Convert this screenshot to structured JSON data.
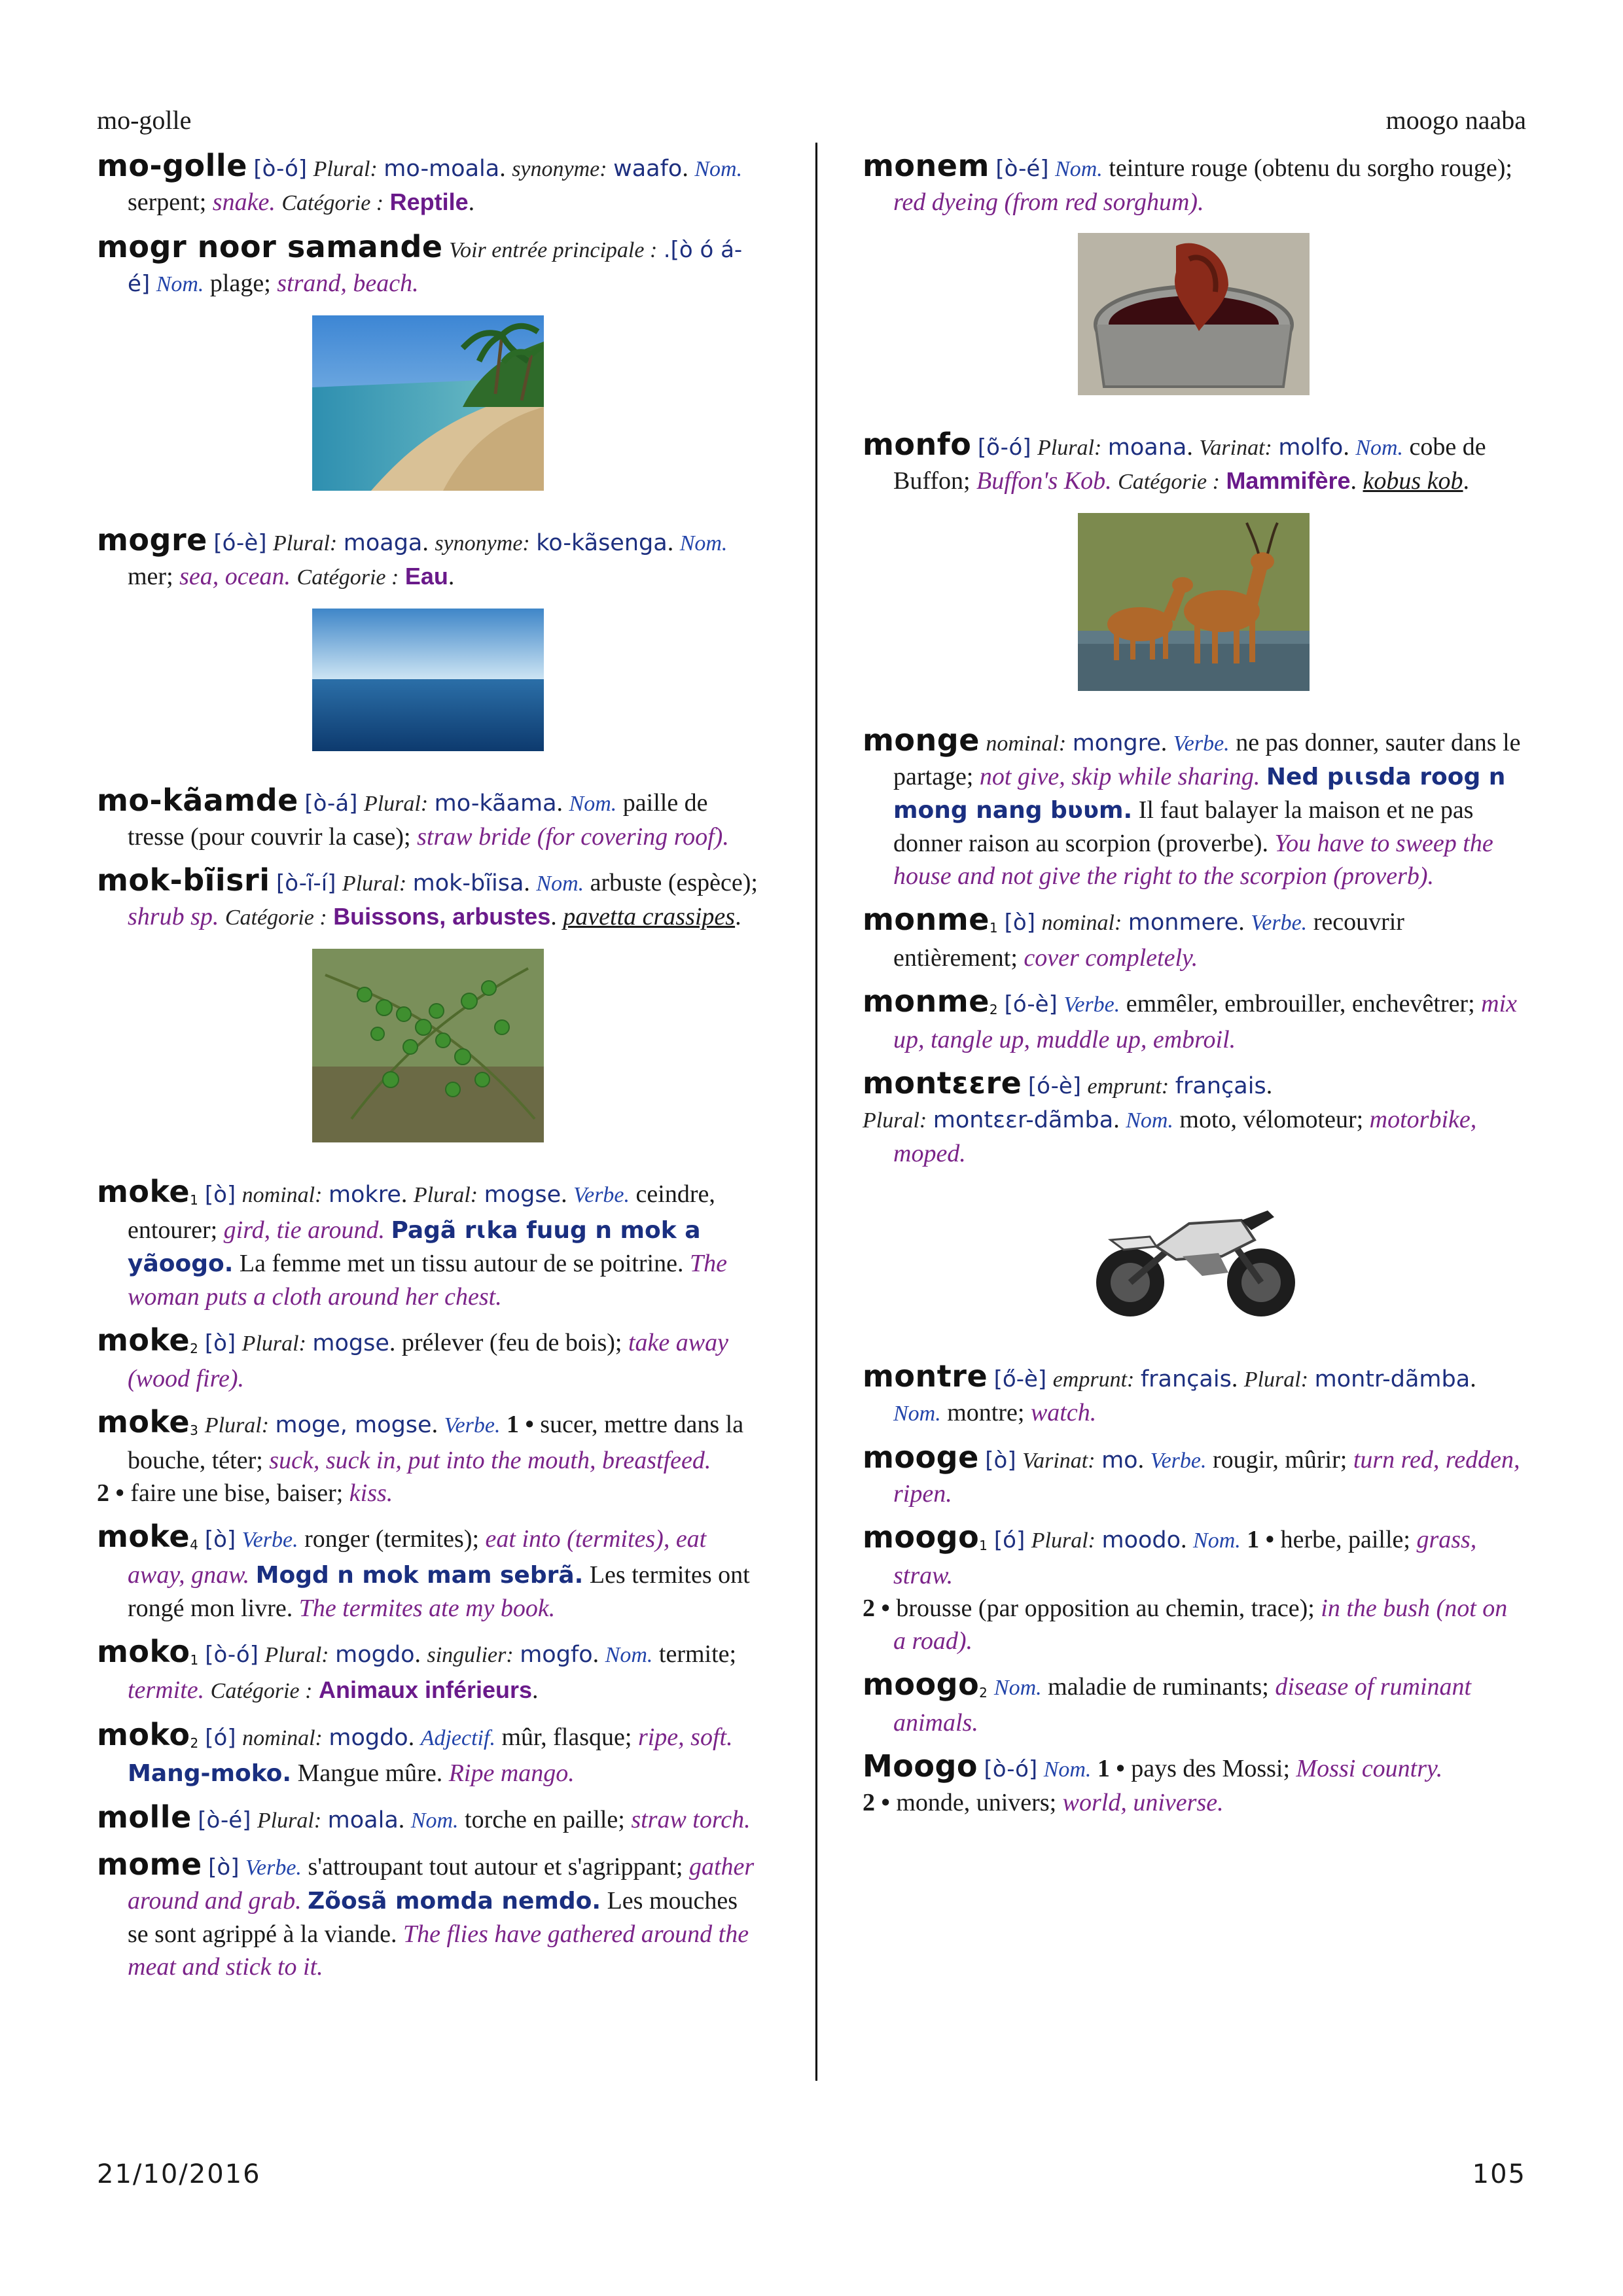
{
  "header": {
    "left": "mo-golle",
    "right": "moogo naaba"
  },
  "footer": {
    "date": "21/10/2016",
    "page": "105"
  },
  "entries": {
    "mogolle": {
      "hw": "mo-golle",
      "pron": "[ò-ó]",
      "plural_lbl": "Plural:",
      "plural": "mo-moala",
      "syn_lbl": "synonyme:",
      "syn": "waafo",
      "pos": "Nom.",
      "fr": "serpent;",
      "en": "snake.",
      "cat_lbl": "Catégorie :",
      "cat": "Reptile"
    },
    "mogr": {
      "hw": "mogr noor samande",
      "voir": "Voir entrée principale :",
      "pron": ".[ò ó á-é]",
      "pos": "Nom.",
      "fr": "plage;",
      "en": "strand, beach."
    },
    "mogre": {
      "hw": "mogre",
      "pron": "[ó-è]",
      "plural_lbl": "Plural:",
      "plural": "moaga",
      "syn_lbl": "synonyme:",
      "syn": "ko-kãsenga",
      "pos": "Nom.",
      "fr": "mer;",
      "en": "sea, ocean.",
      "cat_lbl": "Catégorie :",
      "cat": "Eau"
    },
    "mokaamde": {
      "hw": "mo-kãamde",
      "pron": "[ò-á]",
      "plural_lbl": "Plural:",
      "plural": "mo-kãama",
      "pos": "Nom.",
      "fr": "paille de tresse (pour couvrir la case);",
      "en": "straw bride (for covering roof)."
    },
    "mokbiisri": {
      "hw": "mok-bĩisri",
      "pron": "[ò-ĩ-í]",
      "plural_lbl": "Plural:",
      "plural": "mok-bĩisa",
      "pos": "Nom.",
      "fr": "arbuste (espèce);",
      "en": "shrub sp.",
      "cat_lbl": "Catégorie :",
      "cat": "Buissons, arbustes",
      "sci": "pavetta crassipes"
    },
    "moke1": {
      "hw": "moke",
      "hn": "1",
      "pron": "[ò]",
      "nominal_lbl": "nominal:",
      "nominal": "mokre",
      "plural_lbl": "Plural:",
      "plural": "mogse",
      "pos": "Verbe.",
      "fr": "ceindre, entourer;",
      "en": "gird, tie around.",
      "ex": "Pagã rɩka fuug n mok a yãoogo.",
      "ex_fr": "La femme met un tissu autour de se poitrine.",
      "ex_en": "The woman puts a cloth around her chest."
    },
    "moke2": {
      "hw": "moke",
      "hn": "2",
      "pron": "[ò]",
      "plural_lbl": "Plural:",
      "plural": "mogse",
      "fr": "prélever (feu de bois);",
      "en": "take away (wood fire)."
    },
    "moke3": {
      "hw": "moke",
      "hn": "3",
      "plural_lbl": "Plural:",
      "plural": "moge, mogse",
      "pos": "Verbe.",
      "s1": "1 •",
      "fr1": "sucer, mettre dans la bouche, téter;",
      "en1": "suck, suck in, put into the mouth, breastfeed.",
      "s2": "2 •",
      "fr2": "faire une bise, baiser;",
      "en2": "kiss."
    },
    "moke4": {
      "hw": "moke",
      "hn": "4",
      "pron": "[ò]",
      "pos": "Verbe.",
      "fr": "ronger (termites);",
      "en": "eat into (termites), eat away, gnaw.",
      "ex": "Mogd n mok mam sebrã.",
      "ex_fr": "Les termites ont rongé mon livre.",
      "ex_en": "The termites ate my book."
    },
    "moko1": {
      "hw": "moko",
      "hn": "1",
      "pron": "[ò-ó]",
      "plural_lbl": "Plural:",
      "plural": "mogdo",
      "sing_lbl": "singulier:",
      "sing": "mogfo",
      "pos": "Nom.",
      "fr": "termite;",
      "en": "termite.",
      "cat_lbl": "Catégorie :",
      "cat": "Animaux inférieurs"
    },
    "moko2": {
      "hw": "moko",
      "hn": "2",
      "pron": "[ó]",
      "nominal_lbl": "nominal:",
      "nominal": "mogdo",
      "pos": "Adjectif.",
      "fr": "mûr, flasque;",
      "en": "ripe, soft.",
      "ex": "Mang-moko.",
      "ex_fr": "Mangue mûre.",
      "ex_en": "Ripe mango."
    },
    "molle": {
      "hw": "molle",
      "pron": "[ò-é]",
      "plural_lbl": "Plural:",
      "plural": "moala",
      "pos": "Nom.",
      "fr": "torche en paille;",
      "en": "straw torch."
    },
    "mome": {
      "hw": "mome",
      "pron": "[ò]",
      "pos": "Verbe.",
      "fr": "s'attroupant tout autour et s'agrippant;",
      "en": "gather around and grab.",
      "ex": "Zõosã momda nemdo.",
      "ex_fr": "Les mouches se sont agrippé à la viande.",
      "ex_en": "The flies have gathered around the meat and stick to it."
    },
    "monem": {
      "hw": "monem",
      "pron": "[ò-é]",
      "pos": "Nom.",
      "fr": "teinture rouge (obtenu du sorgho rouge);",
      "en": "red dyeing (from red sorghum)."
    },
    "monfo": {
      "hw": "monfo",
      "pron": "[õ-ó]",
      "plural_lbl": "Plural:",
      "plural": "moana",
      "var_lbl": "Varinat:",
      "var": "molfo",
      "pos": "Nom.",
      "fr": "cobe de Buffon;",
      "en": "Buffon's Kob.",
      "cat_lbl": "Catégorie :",
      "cat": "Mammifère",
      "sci": "kobus kob"
    },
    "monge": {
      "hw": "monge",
      "nominal_lbl": "nominal:",
      "nominal": "mongre",
      "pos": "Verbe.",
      "fr": "ne pas donner, sauter dans le partage;",
      "en": "not give, skip while sharing.",
      "ex": "Ned pɩɩsda roog n mong nang bʋʋm.",
      "ex_fr": "Il faut balayer la maison et ne pas donner raison au scorpion (proverbe).",
      "ex_en": "You have to sweep the house and not give the right to the scorpion (proverb)."
    },
    "monme1": {
      "hw": "monme",
      "hn": "1",
      "pron": "[ò]",
      "nominal_lbl": "nominal:",
      "nominal": "monmere",
      "pos": "Verbe.",
      "fr": "recouvrir entièrement;",
      "en": "cover completely."
    },
    "monme2": {
      "hw": "monme",
      "hn": "2",
      "pron": "[ó-è]",
      "pos": "Verbe.",
      "fr": "emmêler, embrouiller, enchevêtrer;",
      "en": "mix up, tangle up, muddle up, embroil."
    },
    "monteere": {
      "hw": "montɛɛre",
      "pron": "[ó-è]",
      "emp_lbl": "emprunt:",
      "emp": "français",
      "plural_lbl": "Plural:",
      "plural": "montɛɛr-dãmba",
      "pos": "Nom.",
      "fr": "moto, vélomoteur;",
      "en": "motorbike, moped."
    },
    "montre": {
      "hw": "montre",
      "pron": "[ő-è]",
      "emp_lbl": "emprunt:",
      "emp": "français",
      "plural_lbl": "Plural:",
      "plural": "montr-dãmba",
      "pos": "Nom.",
      "fr": "montre;",
      "en": "watch."
    },
    "mooge": {
      "hw": "mooge",
      "pron": "[ò]",
      "var_lbl": "Varinat:",
      "var": "mo",
      "pos": "Verbe.",
      "fr": "rougir, mûrir;",
      "en": "turn red, redden, ripen."
    },
    "moogo1": {
      "hw": "moogo",
      "hn": "1",
      "pron": "[ó]",
      "plural_lbl": "Plural:",
      "plural": "moodo",
      "pos": "Nom.",
      "s1": "1 •",
      "fr1": "herbe, paille;",
      "en1": "grass, straw.",
      "s2": "2 •",
      "fr2": "brousse (par opposition au chemin, trace);",
      "en2": "in the bush (not on a road)."
    },
    "moogo2": {
      "hw": "moogo",
      "hn": "2",
      "pos": "Nom.",
      "fr": "maladie de ruminants;",
      "en": "disease of ruminant animals."
    },
    "Moogo": {
      "hw": "Moogo",
      "pron": "[ò-ó]",
      "pos": "Nom.",
      "s1": "1 •",
      "fr1": "pays des Mossi;",
      "en1": "Mossi country.",
      "s2": "2 •",
      "fr2": "monde, univers;",
      "en2": "world, universe."
    }
  }
}
